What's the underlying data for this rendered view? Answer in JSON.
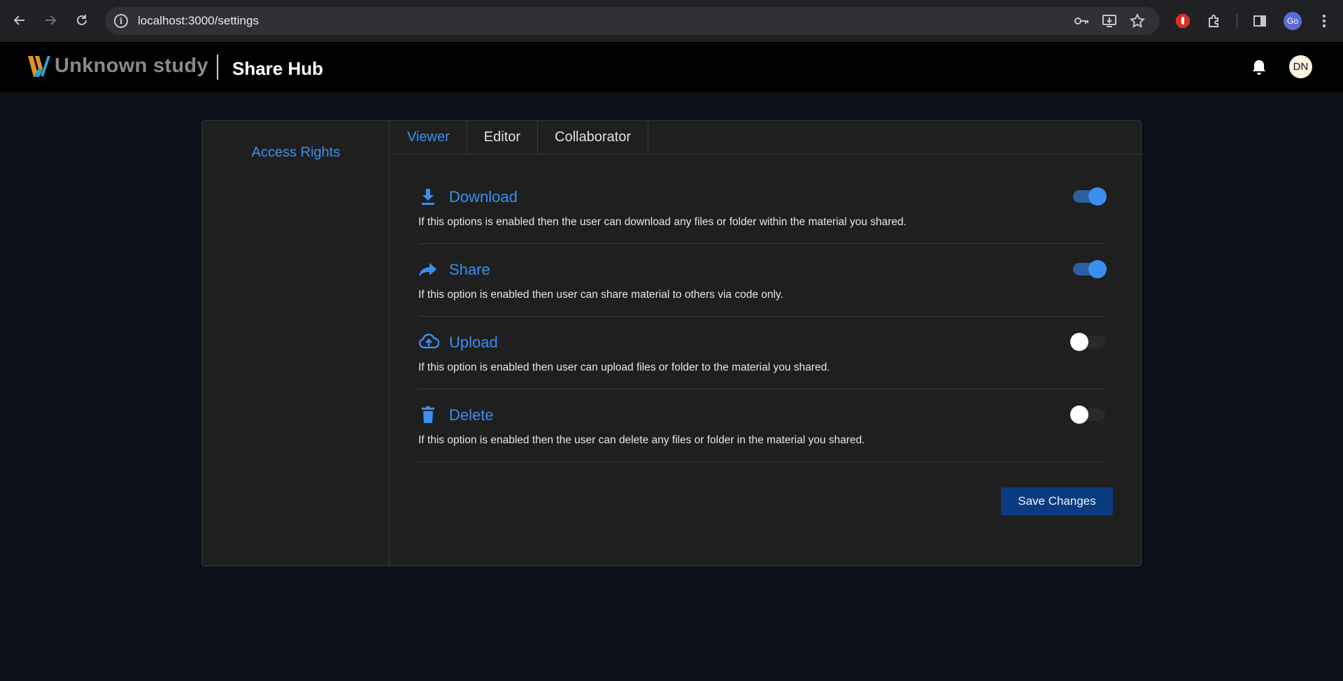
{
  "browser": {
    "url": "localhost:3000/settings",
    "profile_initials": "Go",
    "icons": [
      "back-icon",
      "forward-icon",
      "reload-icon",
      "site-info-icon",
      "key-icon",
      "install-icon",
      "star-icon",
      "extension-stop-icon",
      "puzzle-icon",
      "side-panel-icon",
      "menu-icon"
    ]
  },
  "header": {
    "brand": "Unknown study",
    "app_name": "Share Hub",
    "user_initials": "DN",
    "icons": [
      "logo-icon",
      "bell-icon"
    ]
  },
  "sidebar": {
    "items": [
      {
        "label": "Access Rights"
      }
    ]
  },
  "tabs": [
    {
      "label": "Viewer",
      "active": true
    },
    {
      "label": "Editor",
      "active": false
    },
    {
      "label": "Collaborator",
      "active": false
    }
  ],
  "permissions": [
    {
      "icon": "download-icon",
      "title": "Download",
      "description": "If this options is enabled then the user can download any files or folder within the material you shared.",
      "enabled": true
    },
    {
      "icon": "share-icon",
      "title": "Share",
      "description": "If this option is enabled then user can share material to others via code only.",
      "enabled": true
    },
    {
      "icon": "upload-icon",
      "title": "Upload",
      "description": "If this option is enabled then user can upload files or folder to the material you shared.",
      "enabled": false
    },
    {
      "icon": "delete-icon",
      "title": "Delete",
      "description": "If this option is enabled then the user can delete any files or folder in the material you shared.",
      "enabled": false
    }
  ],
  "actions": {
    "save_label": "Save Changes"
  },
  "colors": {
    "accent": "#3a8ff0",
    "save_button": "#0a3a80",
    "background": "#0b0f17",
    "card": "#1f1f1f"
  }
}
